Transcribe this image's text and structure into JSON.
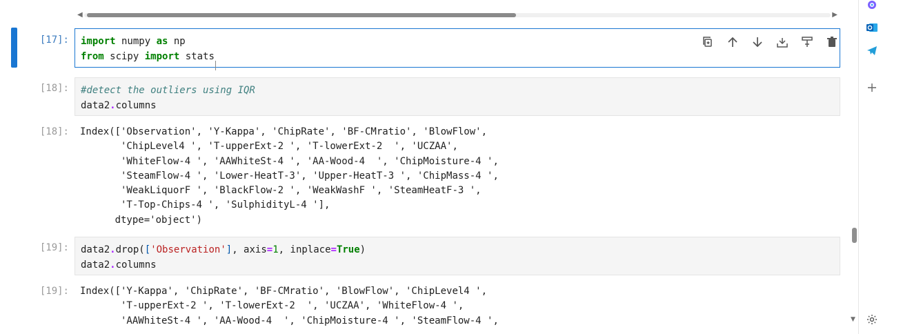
{
  "cells": [
    {
      "prompt": "[17]:",
      "input_lines": [
        [
          {
            "t": "import",
            "c": "kw"
          },
          {
            "t": " numpy "
          },
          {
            "t": "as",
            "c": "kw"
          },
          {
            "t": " np"
          }
        ],
        [
          {
            "t": "from",
            "c": "kw"
          },
          {
            "t": " scipy "
          },
          {
            "t": "import",
            "c": "kw"
          },
          {
            "t": " stats"
          }
        ]
      ]
    },
    {
      "prompt": "[18]:",
      "input_lines": [
        [
          {
            "t": "#detect the outliers using IQR",
            "c": "cm"
          }
        ],
        [
          {
            "t": "data2"
          },
          {
            "t": ".",
            "c": "op"
          },
          {
            "t": "columns"
          }
        ]
      ],
      "output_prompt": "[18]:",
      "output": "Index(['Observation', 'Y-Kappa', 'ChipRate', 'BF-CMratio', 'BlowFlow',\n       'ChipLevel4 ', 'T-upperExt-2 ', 'T-lowerExt-2  ', 'UCZAA',\n       'WhiteFlow-4 ', 'AAWhiteSt-4 ', 'AA-Wood-4  ', 'ChipMoisture-4 ',\n       'SteamFlow-4 ', 'Lower-HeatT-3', 'Upper-HeatT-3 ', 'ChipMass-4 ',\n       'WeakLiquorF ', 'BlackFlow-2 ', 'WeakWashF ', 'SteamHeatF-3 ',\n       'T-Top-Chips-4 ', 'SulphidityL-4 '],\n      dtype='object')"
    },
    {
      "prompt": "[19]:",
      "input_lines": [
        [
          {
            "t": "data2"
          },
          {
            "t": ".",
            "c": "op"
          },
          {
            "t": "drop("
          },
          {
            "t": "[",
            "c": "br"
          },
          {
            "t": "'Observation'",
            "c": "str"
          },
          {
            "t": "]",
            "c": "br"
          },
          {
            "t": ", axis"
          },
          {
            "t": "=",
            "c": "op"
          },
          {
            "t": "1",
            "c": "num"
          },
          {
            "t": ", inplace"
          },
          {
            "t": "=",
            "c": "op"
          },
          {
            "t": "True",
            "c": "kw"
          },
          {
            "t": ")"
          }
        ],
        [
          {
            "t": "data2"
          },
          {
            "t": ".",
            "c": "op"
          },
          {
            "t": "columns"
          }
        ]
      ],
      "output_prompt": "[19]:",
      "output": "Index(['Y-Kappa', 'ChipRate', 'BF-CMratio', 'BlowFlow', 'ChipLevel4 ',\n       'T-upperExt-2 ', 'T-lowerExt-2  ', 'UCZAA', 'WhiteFlow-4 ',\n       'AAWhiteSt-4 ', 'AA-Wood-4  ', 'ChipMoisture-4 ', 'SteamFlow-4 ',"
    }
  ],
  "toolbar": {
    "icons": [
      "duplicate-icon",
      "move-up-icon",
      "move-down-icon",
      "insert-above-icon",
      "insert-below-icon",
      "delete-icon"
    ]
  },
  "sidepanel": {
    "icons": [
      "copilot-icon",
      "outlook-icon",
      "telegram-icon",
      "add-icon",
      "settings-icon"
    ]
  },
  "colors": {
    "accent": "#1976d2",
    "keyword": "#008000",
    "comment": "#408080",
    "string": "#ba2121"
  }
}
